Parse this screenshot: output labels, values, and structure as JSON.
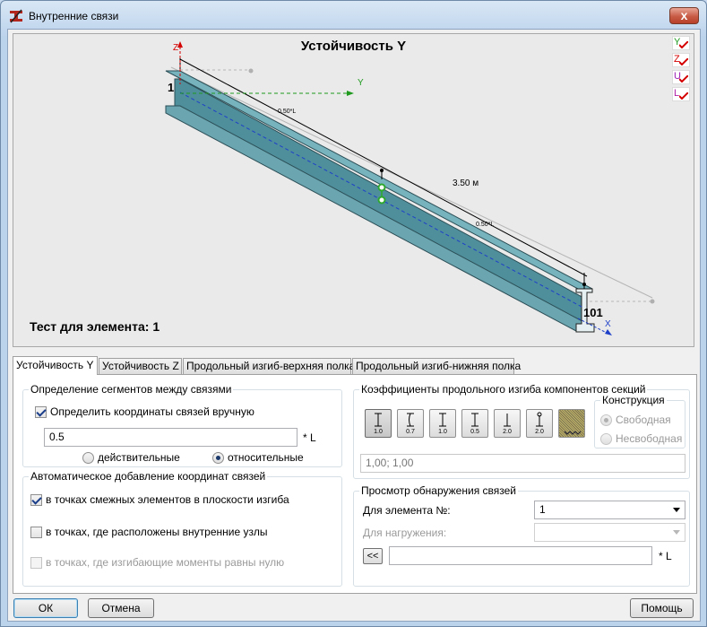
{
  "window": {
    "title": "Внутренние связи",
    "close_glyph": "x",
    "colors": {
      "titlebar": "#bcd3ec",
      "close": "#c75b45",
      "beam": "#4f8f9b",
      "accent": "#3c7fb1"
    }
  },
  "viewport": {
    "title": "Устойчивость Y",
    "test_label": "Тест для элемента: 1",
    "axis_z": "Z",
    "axis_y": "Y",
    "axis_x": "X",
    "node_start": "1",
    "node_end": "101",
    "length_label": "3.50 м",
    "seg_label_1": "0.50*L",
    "seg_label_2": "0.50*L",
    "flags": [
      {
        "letter": "Y",
        "color": "#1f9a1f"
      },
      {
        "letter": "Z",
        "color": "#d40000"
      },
      {
        "letter": "U",
        "color": "#9c1fb5"
      },
      {
        "letter": "L",
        "color": "#b01fa8"
      }
    ]
  },
  "tabs": [
    {
      "label": "Устойчивость Y",
      "active": true
    },
    {
      "label": "Устойчивость Z",
      "active": false
    },
    {
      "label": "Продольный изгиб-верхняя полка",
      "active": false
    },
    {
      "label": "Продольный изгиб-нижняя полка",
      "active": false
    }
  ],
  "segments": {
    "legend": "Определение сегментов между связями",
    "manual_label": "Определить координаты связей вручную",
    "manual_checked": true,
    "coords_value": "0.5",
    "unit": "* L",
    "radio_actual": "действительные",
    "radio_relative": "относительные",
    "selected": "relative"
  },
  "auto": {
    "legend": "Автоматическое добавление координат связей",
    "items": [
      {
        "label": "в точках смежных элементов в плоскости изгиба",
        "checked": true,
        "disabled": false
      },
      {
        "label": "в точках, где расположены внутренние узлы",
        "checked": false,
        "disabled": false
      },
      {
        "label": "в точках, где изгибающие моменты равны нулю",
        "checked": false,
        "disabled": true
      }
    ]
  },
  "coefficients": {
    "legend": "Коэффициенты продольного изгиба компонентов секций",
    "buttons": [
      "1.0",
      "0.7",
      "1.0",
      "0.5",
      "2.0",
      "2.0"
    ],
    "dotted_button_icon": "restraint-pattern-icon",
    "construction_legend": "Конструкция",
    "free": "Свободная",
    "non_free": "Несвободная",
    "selected": "free",
    "value": "1,00; 1,00"
  },
  "detection": {
    "legend": "Просмотр обнаружения связей",
    "element_label": "Для элемента №:",
    "element_value": "1",
    "load_label": "Для нагружения:",
    "load_value": "",
    "back_button": "<<",
    "field_value": "",
    "unit": "* L"
  },
  "footer": {
    "ok": "ОК",
    "cancel": "Отмена",
    "help": "Помощь"
  }
}
